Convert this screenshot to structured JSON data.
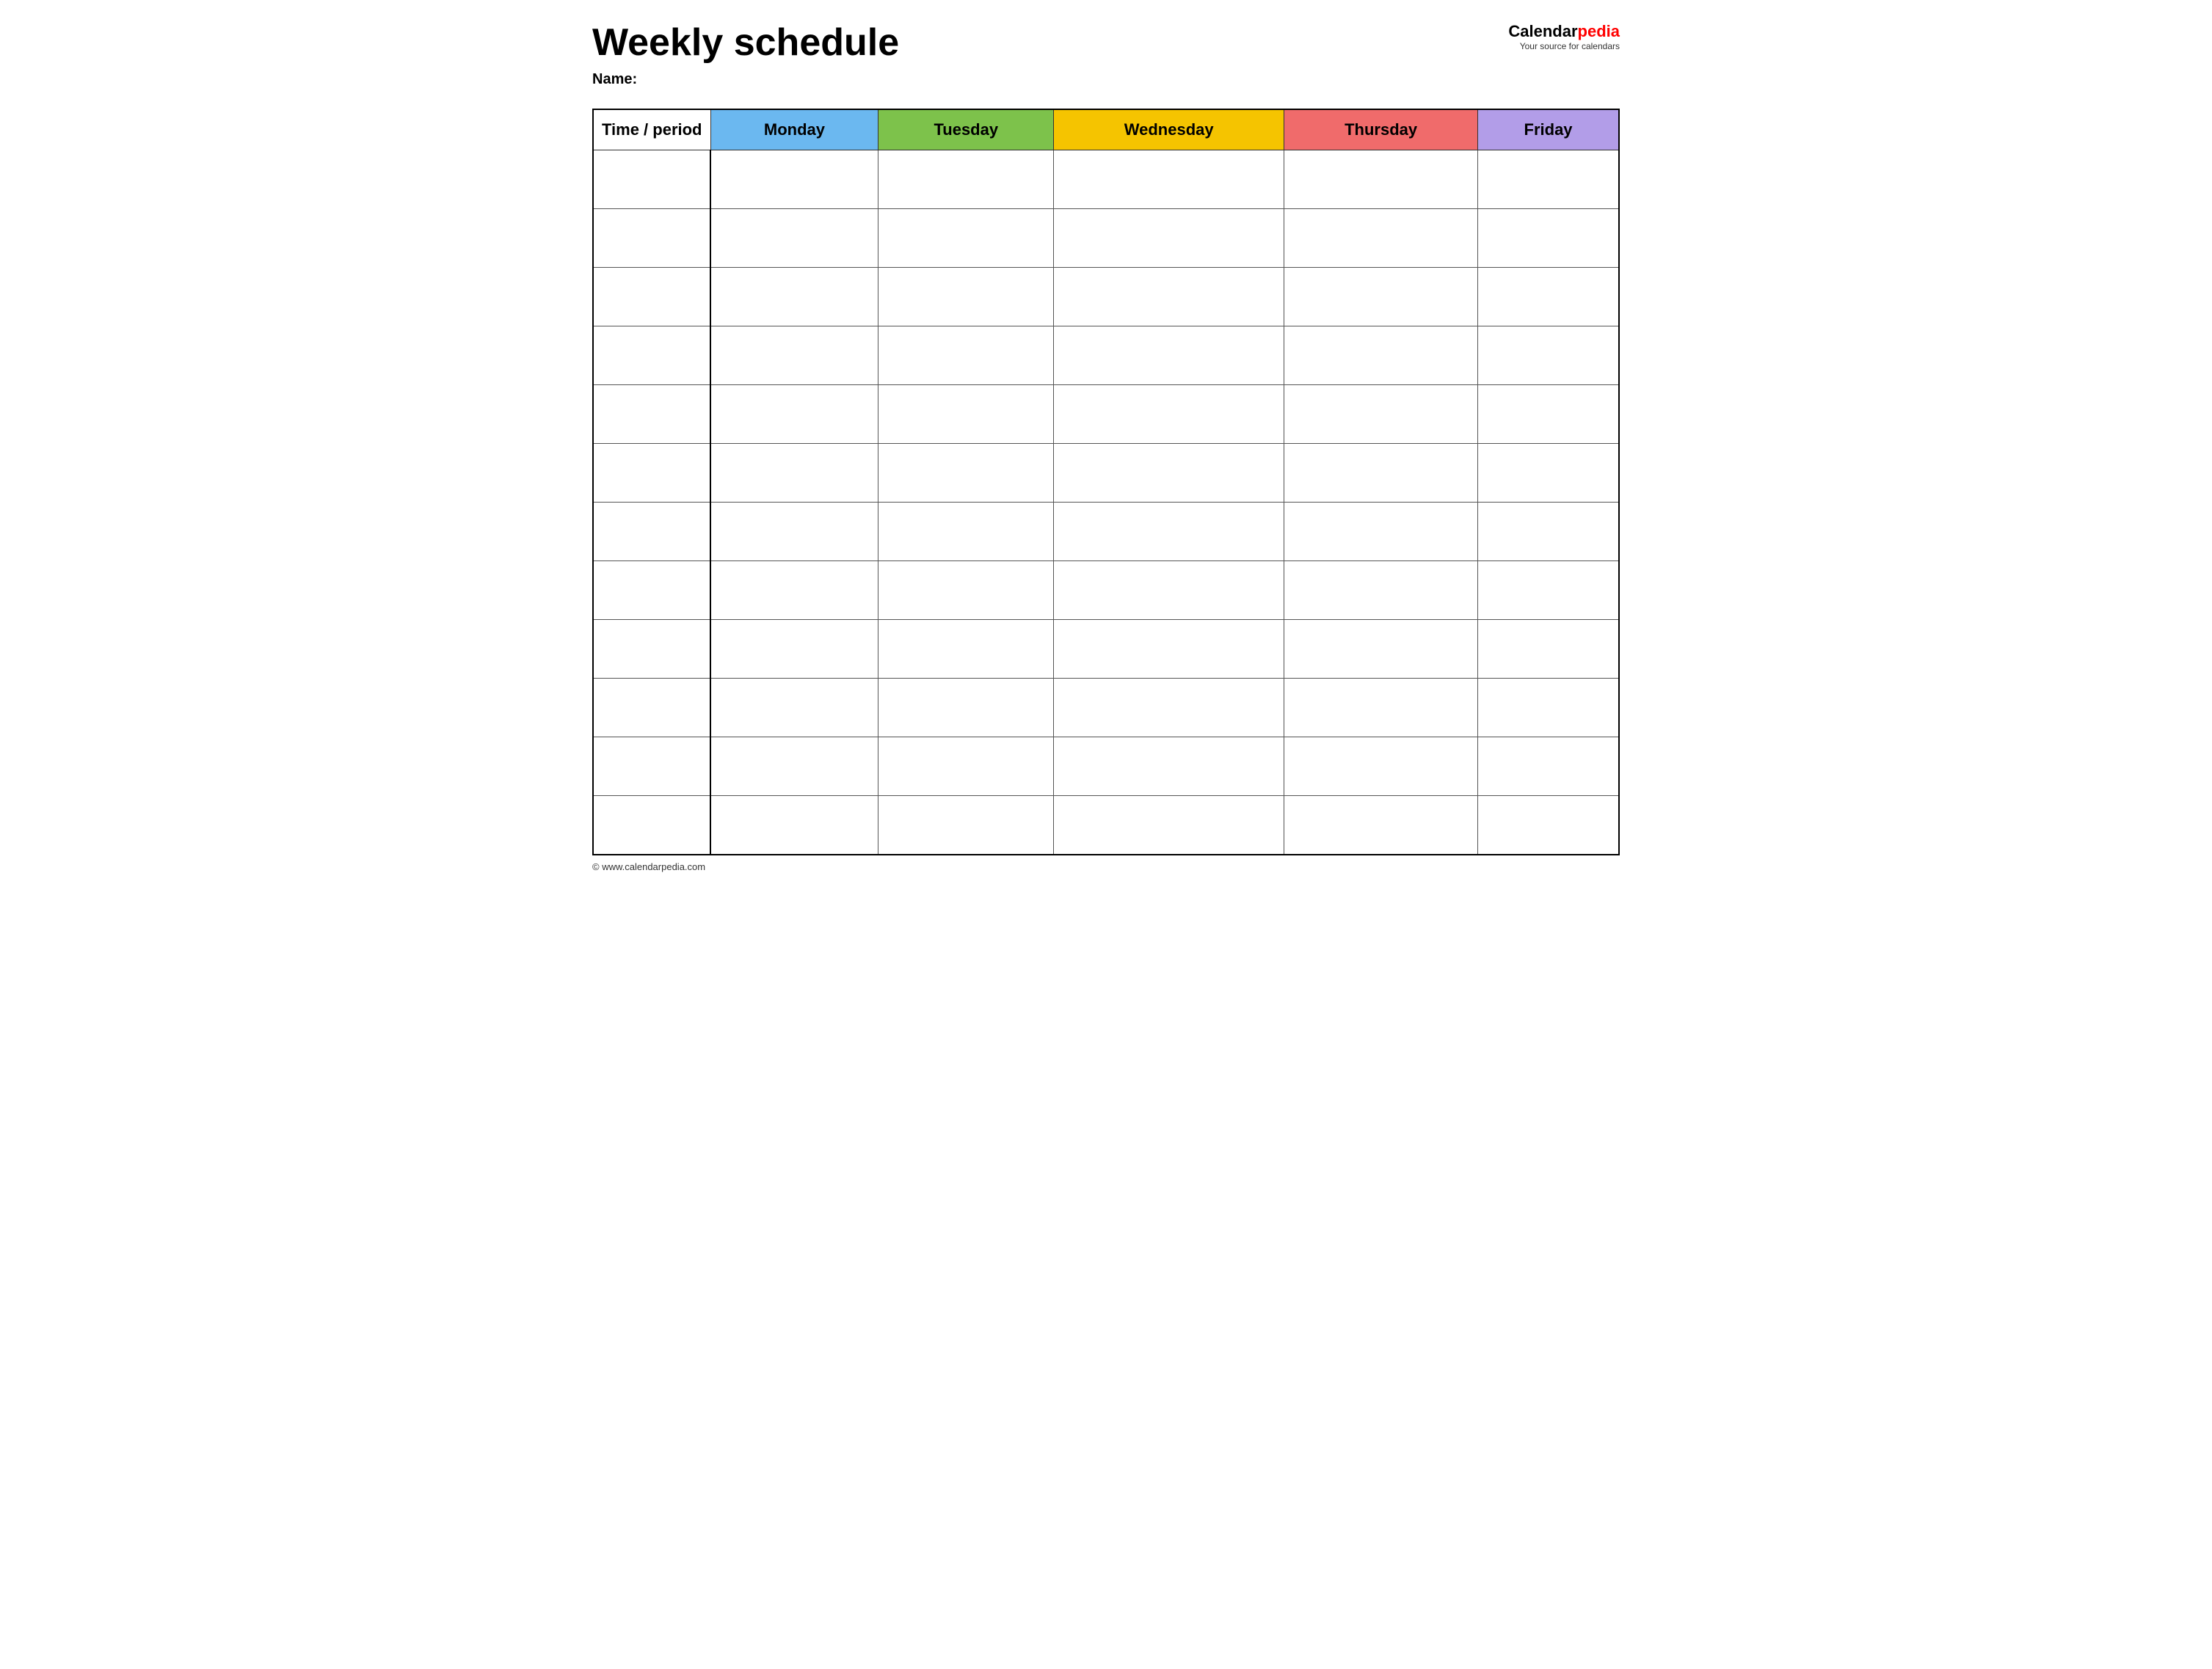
{
  "header": {
    "title": "Weekly schedule",
    "name_label": "Name:",
    "logo": {
      "calendar_text": "Calendar",
      "pedia_text": "pedia",
      "tagline": "Your source for calendars"
    }
  },
  "table": {
    "headers": [
      {
        "id": "time",
        "label": "Time / period",
        "color_class": "col-time"
      },
      {
        "id": "monday",
        "label": "Monday",
        "color_class": "col-monday"
      },
      {
        "id": "tuesday",
        "label": "Tuesday",
        "color_class": "col-tuesday"
      },
      {
        "id": "wednesday",
        "label": "Wednesday",
        "color_class": "col-wednesday"
      },
      {
        "id": "thursday",
        "label": "Thursday",
        "color_class": "col-thursday"
      },
      {
        "id": "friday",
        "label": "Friday",
        "color_class": "col-friday"
      }
    ],
    "row_count": 12
  },
  "footer": {
    "copyright": "© www.calendarpedia.com"
  }
}
